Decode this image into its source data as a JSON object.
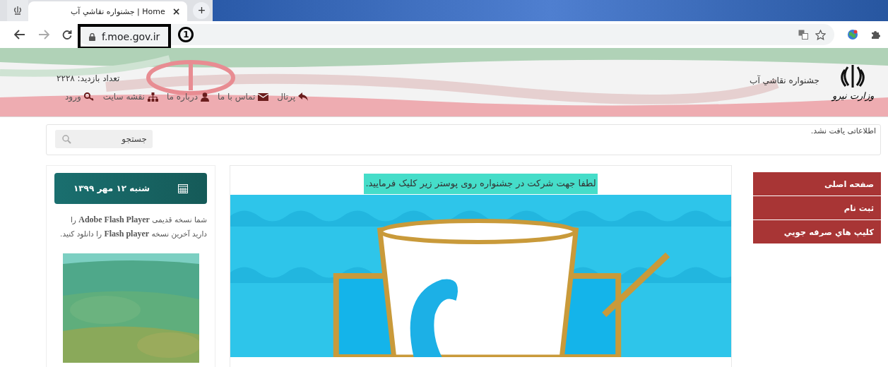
{
  "browser": {
    "tab": {
      "title": "جشنواره نقاشي آب | Home",
      "close": "×",
      "selected": true
    },
    "new_tab": "+",
    "address": "f.moe.gov.ir",
    "annotation_number": "1"
  },
  "header": {
    "site_title": "جشنواره نقاشي آب",
    "logo_caption": "وزارت نیرو",
    "visit_count": "تعداد بازدید: ۲۲۲۸",
    "nav": [
      {
        "label": "پرتال",
        "kind": "reply"
      },
      {
        "label": "تماس با ما",
        "kind": "envelope"
      },
      {
        "label": "درباره ما",
        "kind": "user"
      },
      {
        "label": "نقشه سایت",
        "kind": "sitemap"
      },
      {
        "label": "ورود",
        "kind": "key"
      }
    ]
  },
  "search": {
    "placeholder": "جستجو",
    "notice": "اطلاعاتی یافت نشد."
  },
  "menu": [
    {
      "label": "صفحه اصلی"
    },
    {
      "label": "ثبت نام"
    },
    {
      "label": "کلیپ هاي صرفه جويي"
    }
  ],
  "main": {
    "banner_text": "لطفا جهت شرکت در جشنواره روی پوستر زیر کلیک فرمایید."
  },
  "sidebar": {
    "date": "شنبه ۱۲ مهر ۱۳۹۹",
    "flash_notice": "شما نسخه قدیمی **Adobe Flash Player** را دارید آخرین نسخه **Flash player** را دانلود کنید."
  }
}
